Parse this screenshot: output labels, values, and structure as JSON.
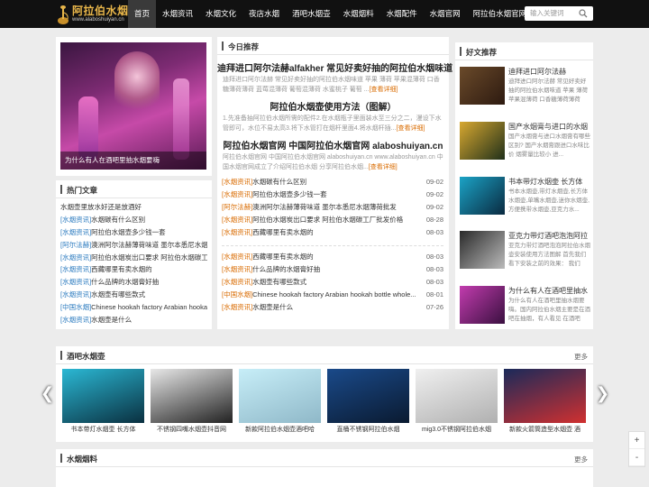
{
  "header": {
    "site_name": "阿拉伯水烟网",
    "site_url": "www.alaboshuiyan.cn",
    "nav": [
      "首页",
      "水烟资讯",
      "水烟文化",
      "夜店水烟",
      "酒吧水烟壶",
      "水烟烟料",
      "水烟配件",
      "水烟官网",
      "阿拉伯水烟官网"
    ],
    "search_placeholder": "输入关键词"
  },
  "feature": {
    "caption": "为什么有人在酒吧里抽水烟要嗨"
  },
  "hot": {
    "title": "热门文章",
    "items": [
      {
        "tag": "",
        "text": "水烟壶里放水好还是放酒好"
      },
      {
        "tag": "[水烟资讯]",
        "text": "水烟碳有什么区别"
      },
      {
        "tag": "[水烟资讯]",
        "text": "阿拉伯水烟壶多少钱一套"
      },
      {
        "tag": "[阿尔法赫]",
        "text": "澳洲阿尔法赫薄荷味道 墨尔本悉尼水烟薄荷"
      },
      {
        "tag": "[水烟资讯]",
        "text": "阿拉伯水烟炭出口要求 阿拉伯水烟碳工"
      },
      {
        "tag": "[水烟资讯]",
        "text": "西藏哪里有卖水烟的"
      },
      {
        "tag": "[水烟资讯]",
        "text": "什么品牌的水烟膏好抽"
      },
      {
        "tag": "[水烟资讯]",
        "text": "水烟壶有哪些款式"
      },
      {
        "tag": "[中国水烟]",
        "text": "Chinese hookah factory Arabian hookah"
      },
      {
        "tag": "[水烟资讯]",
        "text": "水烟壶是什么"
      }
    ]
  },
  "today": {
    "title": "今日推荐",
    "articles": [
      {
        "headline": "迪拜进口阿尔法赫alfakher 常见好卖好抽的阿拉伯水烟味道",
        "desc": "迪拜进口阿尔法赫 常见好卖好抽的阿拉伯水烟味道 苹果 薄荷 苹果混薄荷 口香糖薄荷薄荷 蓝莓混薄荷 葡萄混薄荷 水蜜桃子 葡萄 ...",
        "more": "[查看详细]"
      },
      {
        "headline": "阿拉伯水烟壶使用方法（图解）",
        "desc": "1.先准备抽阿拉伯水烟所需的配件2.在水烟瓶子里面装水至三分之二，漫设下水管即可，水位不易太高3.将下水管打在烟杆里面4.将水烟杆插...",
        "more": "[查看详细]"
      },
      {
        "headline": "阿拉伯水烟官网 中国阿拉伯水烟官网 alaboshuiyan.cn",
        "desc": "阿拉伯水烟官网 中国阿拉伯水烟官网 alaboshuiyan.cn www.alaboshuiyan.cn 中国水烟官网成立了介绍阿拉伯水烟 分享阿拉伯水烟...",
        "more": "[查看详细]"
      }
    ],
    "news": [
      {
        "tag": "[水烟资讯]",
        "text": "水烟碳有什么区别",
        "date": "09-02"
      },
      {
        "tag": "[水烟资讯]",
        "text": "阿拉伯水烟壶多少钱一套",
        "date": "09-02"
      },
      {
        "tag": "[阿尔法赫]",
        "text": "澳洲阿尔法赫薄荷味道 墨尔本悉尼水烟薄荷批发",
        "date": "09-02"
      },
      {
        "tag": "[水烟资讯]",
        "text": "阿拉伯水烟炭出口要求 阿拉伯水烟碳工厂批发价格",
        "date": "08-28"
      },
      {
        "tag": "[水烟资讯]",
        "text": "西藏哪里有卖水烟的",
        "date": "08-03"
      },
      {
        "tag": "[水烟资讯]",
        "text": "西藏哪里有卖水烟的",
        "date": "08-03"
      },
      {
        "tag": "[水烟资讯]",
        "text": "什么品牌的水烟膏好抽",
        "date": "08-03"
      },
      {
        "tag": "[水烟资讯]",
        "text": "水烟壶有哪些款式",
        "date": "08-03"
      },
      {
        "tag": "[中国水烟]",
        "text": "Chinese hookah factory Arabian hookah bottle whole...",
        "date": "08-01"
      },
      {
        "tag": "[水烟资讯]",
        "text": "水烟壶是什么",
        "date": "07-26"
      }
    ]
  },
  "good": {
    "title": "好文推荐",
    "items": [
      {
        "title": "迪拜进口阿尔法赫",
        "desc": "迪拜进口阿尔法赫 常见好卖好抽的阿拉伯水烟味道 苹果 薄荷 苹果混薄荷 口香糖薄荷薄荷",
        "colors": [
          "#6a4a2a",
          "#2d1a10"
        ]
      },
      {
        "title": "国产水烟膏与进口的水烟",
        "desc": "国产水烟膏与进口水烟膏有哪些区别? 国产水烟膏跟进口水味比价 烟雾量比较小 进...",
        "colors": [
          "#d8a830",
          "#20301a"
        ]
      },
      {
        "title": "书本带灯水烟壶 长方体",
        "desc": "书本水烟壶,带灯水烟壶,长方体水烟壶,单嘴水烟壶,迷你水烟壶,方便携带水烟壶,亚克力水...",
        "colors": [
          "#1ba3c6",
          "#0a2a40"
        ]
      },
      {
        "title": "亚克力带灯酒吧泡泡阿拉",
        "desc": "亚克力带灯酒吧泡泡阿拉伯水烟壶安装使用方法图解 首先我们看下安装之前的效果： 我们",
        "colors": [
          "#2a2a2a",
          "#bbbbbb"
        ]
      },
      {
        "title": "为什么有人在酒吧里抽水",
        "desc": "为什么有人在酒吧里抽水烟要嗨。国内阿拉伯水烟主要是在酒吧在抽烟，有人看见 在酒吧",
        "colors": [
          "#c23cae",
          "#3a1040"
        ]
      }
    ]
  },
  "bar_section": {
    "title": "酒吧水烟壶",
    "more": "更多",
    "items": [
      {
        "caption": "书本带灯水烟壶 长方体",
        "colors": [
          "#2bb8d4",
          "#0a3040"
        ]
      },
      {
        "caption": "不锈钢四嘴水烟壶抖音网",
        "colors": [
          "#e8e8e8",
          "#222222"
        ]
      },
      {
        "caption": "新款阿拉伯水烟壶酒吧哈",
        "colors": [
          "#c7eef8",
          "#8fb8c8"
        ]
      },
      {
        "caption": "直桶不锈钢阿拉伯水烟",
        "colors": [
          "#1a4a8a",
          "#0a1a30"
        ]
      },
      {
        "caption": "mig3.0不锈钢阿拉伯水烟",
        "colors": [
          "#f0f0f0",
          "#b0b0b0"
        ]
      },
      {
        "caption": "新款火箭筒造型水烟壶 酒",
        "colors": [
          "#1a2a5a",
          "#d03030"
        ]
      }
    ]
  },
  "tobacco_section": {
    "title": "水烟烟料",
    "more": "更多"
  },
  "side_tools": [
    "+",
    "-"
  ],
  "more_label": "更多"
}
